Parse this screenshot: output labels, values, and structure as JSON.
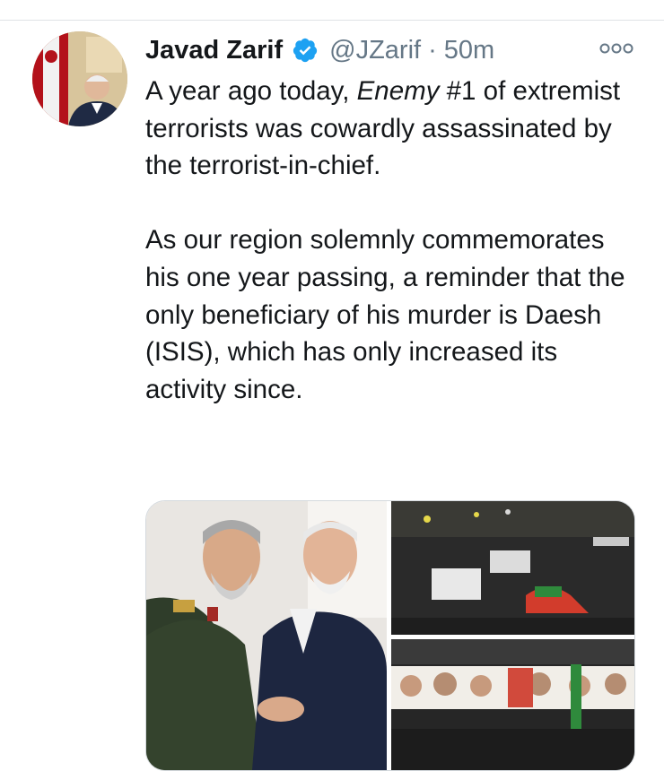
{
  "tweet": {
    "author_name": "Javad Zarif",
    "handle": "@JZarif",
    "separator": "·",
    "time": "50m",
    "text_part1": "A year ago today, ",
    "text_italic": "Enemy",
    "text_part2": " #1 of extremist terrorists was cowardly assassinated by the terrorist-in-chief.\n\nAs our region solemnly commemorates his one year passing, a reminder that the only beneficiary of his murder is Daesh (ISIS), which has only increased its activity since."
  },
  "icons": {
    "verified": "verified-badge-icon",
    "more": "more-options-icon"
  },
  "colors": {
    "verified_blue": "#1da1f2",
    "secondary_text": "#657786",
    "primary_text": "#14171a"
  }
}
